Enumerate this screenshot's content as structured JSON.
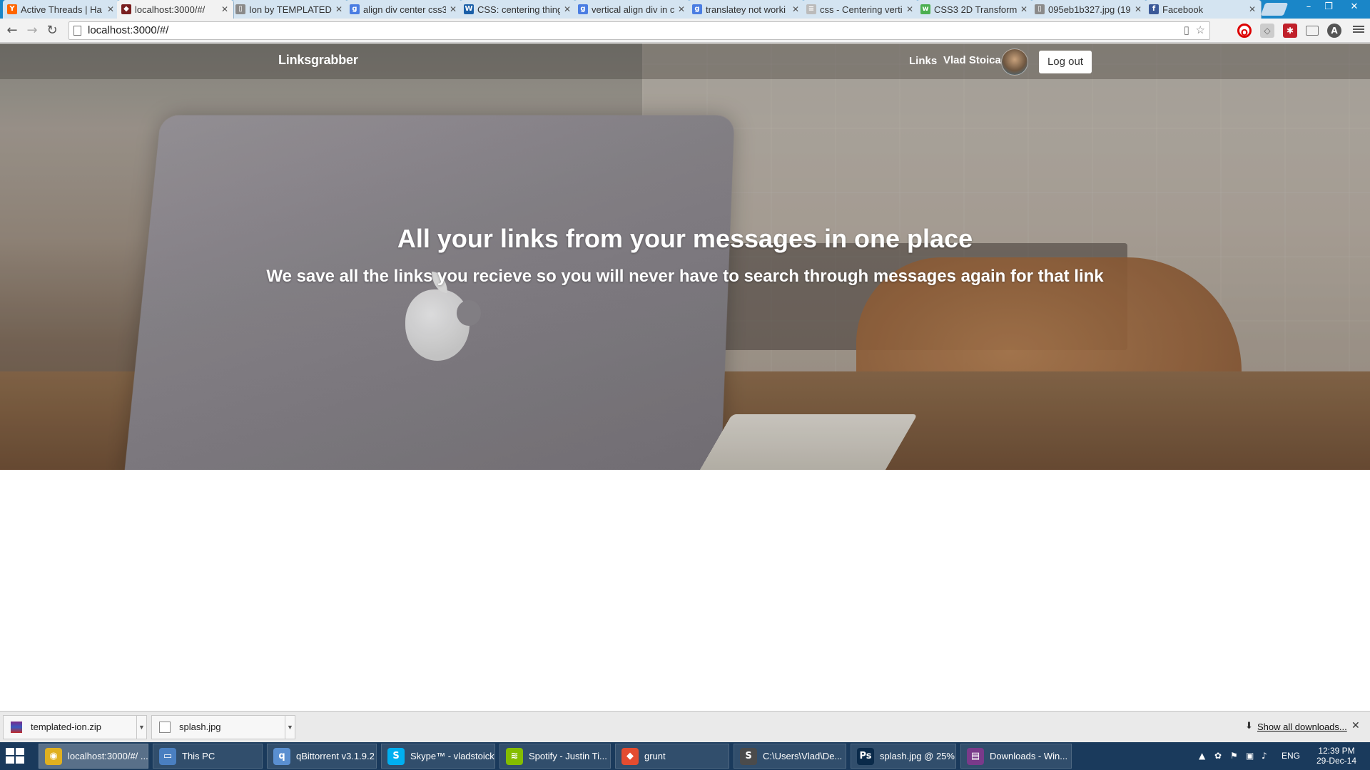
{
  "browser": {
    "tabs": [
      {
        "title": "Active Threads | Ha",
        "favicon": "hacker-news-icon",
        "color": "#ff6600",
        "glyph": "Y"
      },
      {
        "title": "localhost:3000/#/",
        "favicon": "spy-icon",
        "color": "#7a1f1f",
        "glyph": "◆"
      },
      {
        "title": "Ion by TEMPLATED",
        "favicon": "page-icon",
        "color": "#8a8a8a",
        "glyph": "▯"
      },
      {
        "title": "align div center css3",
        "favicon": "google-icon",
        "color": "#4a7de2",
        "glyph": "g"
      },
      {
        "title": "CSS: centering thing",
        "favicon": "w3c-icon",
        "color": "#1a5fa8",
        "glyph": "W"
      },
      {
        "title": "vertical align div in c",
        "favicon": "google-icon",
        "color": "#4a7de2",
        "glyph": "g"
      },
      {
        "title": "translatey not worki",
        "favicon": "google-icon",
        "color": "#4a7de2",
        "glyph": "g"
      },
      {
        "title": "css - Centering verti",
        "favicon": "stackoverflow-icon",
        "color": "#bbbbbb",
        "glyph": "≡"
      },
      {
        "title": "CSS3 2D Transform",
        "favicon": "w3schools-icon",
        "color": "#4caf50",
        "glyph": "w"
      },
      {
        "title": "095eb1b327.jpg (19",
        "favicon": "page-icon",
        "color": "#8a8a8a",
        "glyph": "▯"
      },
      {
        "title": "Facebook",
        "favicon": "facebook-icon",
        "color": "#3b5998",
        "glyph": "f"
      }
    ],
    "url": "localhost:3000/#/"
  },
  "site": {
    "brand": "Linksgrabber",
    "nav_links": "Links",
    "user_name": "Vlad Stoica",
    "logout": "Log out",
    "hero_title": "All your links from your messages in one place",
    "hero_subtitle": "We save all the links you recieve so you will never have to search through messages again for that link"
  },
  "downloads": {
    "items": [
      {
        "name": "templated-ion.zip",
        "icon": "winrar-archive-icon"
      },
      {
        "name": "splash.jpg",
        "icon": "image-file-icon"
      }
    ],
    "show_all": "Show all downloads..."
  },
  "taskbar": {
    "items": [
      {
        "label": "localhost:3000/#/ ...",
        "icon": "chrome-icon",
        "color": "#e0b020",
        "glyph": "◉"
      },
      {
        "label": "This PC",
        "icon": "this-pc-icon",
        "color": "#4a7fc0",
        "glyph": "▭"
      },
      {
        "label": "qBittorrent v3.1.9.2",
        "icon": "qbittorrent-icon",
        "color": "#5a8fd0",
        "glyph": "q"
      },
      {
        "label": "Skype™ - vladstoick",
        "icon": "skype-icon",
        "color": "#00aff0",
        "glyph": "S"
      },
      {
        "label": "Spotify - Justin Ti...",
        "icon": "spotify-icon",
        "color": "#84bd00",
        "glyph": "≋"
      },
      {
        "label": "grunt",
        "icon": "git-icon",
        "color": "#e44c30",
        "glyph": "◆"
      },
      {
        "label": "C:\\Users\\Vlad\\De...",
        "icon": "sublime-text-icon",
        "color": "#4b4b4b",
        "glyph": "S"
      },
      {
        "label": "splash.jpg @ 25% ...",
        "icon": "photoshop-icon",
        "color": "#0a2a4a",
        "glyph": "Ps"
      },
      {
        "label": "Downloads - Win...",
        "icon": "winrar-icon",
        "color": "#7a3a8a",
        "glyph": "▤"
      }
    ],
    "language": "ENG",
    "time": "12:39 PM",
    "date": "29-Dec-14"
  }
}
